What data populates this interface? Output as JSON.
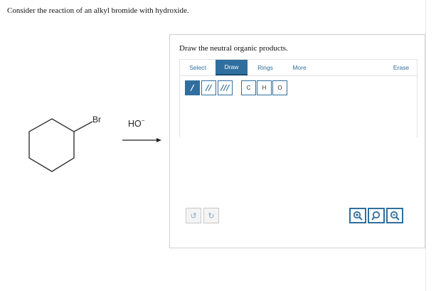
{
  "question": {
    "text": "Consider the reaction of an alkyl bromide with hydroxide."
  },
  "scheme": {
    "substituent_label": "Br",
    "reagent": "HO",
    "reagent_charge": "−"
  },
  "editor": {
    "prompt": "Draw the neutral organic products.",
    "tabs": [
      "Select",
      "Draw",
      "Rings",
      "More",
      "Erase"
    ],
    "active_tab": "Draw",
    "bond_tools": [
      "/",
      "//",
      "///"
    ],
    "atom_tools": [
      "C",
      "H",
      "O"
    ],
    "undo_icon": "undo-icon",
    "redo_icon": "redo-icon",
    "zoom_icons": [
      "zoom-in-icon",
      "zoom-reset-icon",
      "zoom-out-icon"
    ],
    "accent_color": "#2f6f9f"
  }
}
